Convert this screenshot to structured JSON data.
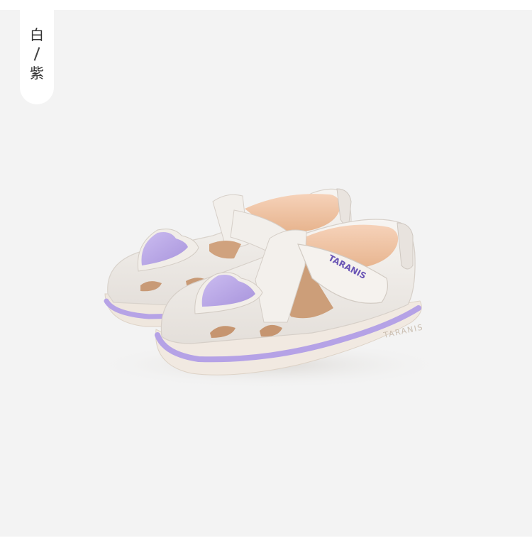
{
  "color_tag": {
    "top": "白",
    "bottom": "紫"
  },
  "product": {
    "brand_on_strap": "TARANIS",
    "brand_on_sole": "TARANIS"
  },
  "colors": {
    "background": "#f3f3f3",
    "leather": "#eeeae6",
    "accent_purple": "#b9a6e3",
    "lining": "#f3c9ad",
    "sole": "#f1e9e1"
  }
}
